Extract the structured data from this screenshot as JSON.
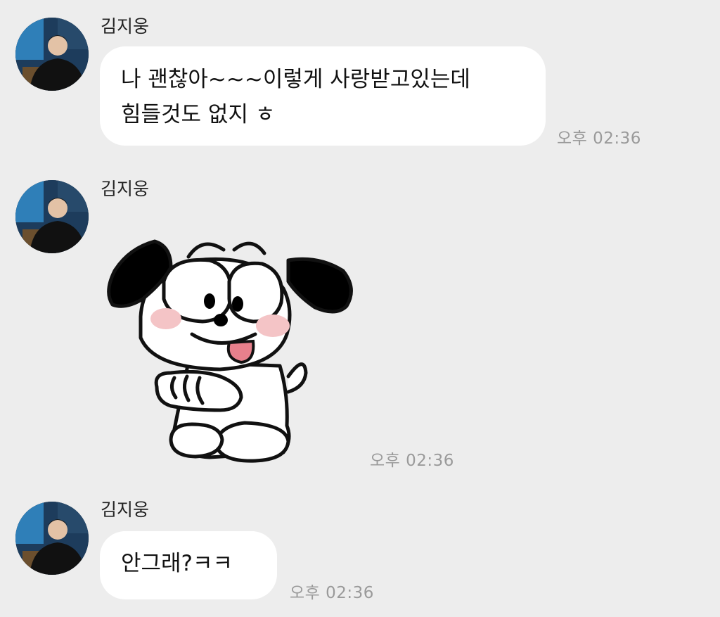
{
  "messages": [
    {
      "sender": "김지웅",
      "text_line1": "나 괜찮아~~~이렇게 사랑받고있는데",
      "text_line2": "힘들것도 없지 ㅎ",
      "time": "오후 02:36"
    },
    {
      "sender": "김지웅",
      "type": "sticker",
      "sticker": "white-puppy-tongue-out",
      "time": "오후 02:36"
    },
    {
      "sender": "김지웅",
      "text": "안그래?ㅋㅋ",
      "time": "오후 02:36"
    }
  ]
}
